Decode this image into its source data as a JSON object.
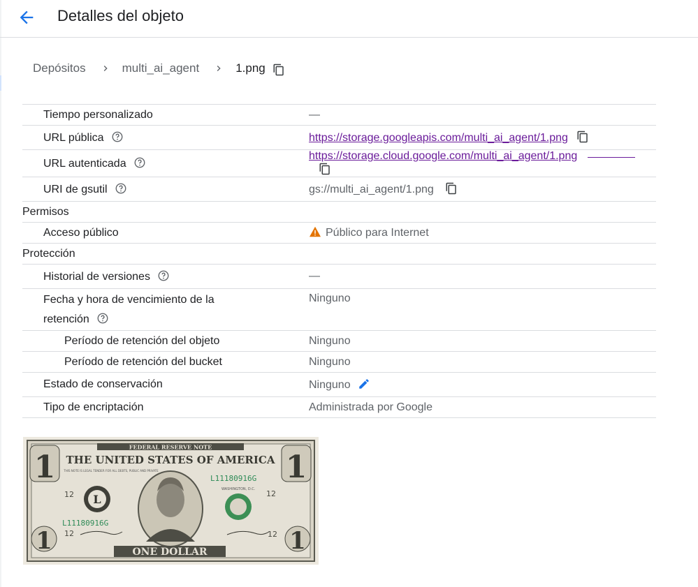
{
  "header": {
    "title": "Detalles del objeto",
    "back_icon": "arrow-back-icon"
  },
  "breadcrumb": {
    "items": [
      "Depósitos",
      "multi_ai_agent"
    ],
    "current": "1.png"
  },
  "properties": [
    {
      "label": "Tiempo personalizado",
      "value": "—"
    },
    {
      "label": "URL pública",
      "value": "https://storage.googleapis.com/multi_ai_agent/1.png"
    },
    {
      "label": "URL autenticada",
      "value": "https://storage.cloud.google.com/multi_ai_agent/1.png"
    },
    {
      "label": "URI de gsutil",
      "value": "gs://multi_ai_agent/1.png"
    }
  ],
  "permissions": {
    "section": "Permisos",
    "public_access_label": "Acceso público",
    "public_access_value": "Público para Internet"
  },
  "protection": {
    "section": "Protección",
    "version_history_label": "Historial de versiones",
    "version_history_value": "—",
    "retention_expiry_label_1": "Fecha y hora de vencimiento de la",
    "retention_expiry_label_2": "retención",
    "retention_expiry_value": "Ninguno",
    "object_retention_label": "Período de retención del objeto",
    "object_retention_value": "Ninguno",
    "bucket_retention_label": "Período de retención del bucket",
    "bucket_retention_value": "Ninguno",
    "hold_label": "Estado de conservación",
    "hold_value": "Ninguno",
    "encryption_label": "Tipo de encriptación",
    "encryption_value": "Administrada por Google"
  },
  "preview": {
    "top_banner": "FEDERAL RESERVE NOTE",
    "country": "THE UNITED STATES OF AMERICA",
    "bottom_banner": "ONE DOLLAR",
    "serial": "L11180916G",
    "seal_letter": "L",
    "corner_number": "1",
    "position_number": "12",
    "small_text": "WASHINGTON, D.C.",
    "legal_text": "THIS NOTE IS LEGAL TENDER FOR ALL DEBTS, PUBLIC AND PRIVATE"
  },
  "colors": {
    "accent": "#1a73e8",
    "link": "#6a1b9a",
    "warning": "#e37400",
    "border": "#dadce0"
  }
}
